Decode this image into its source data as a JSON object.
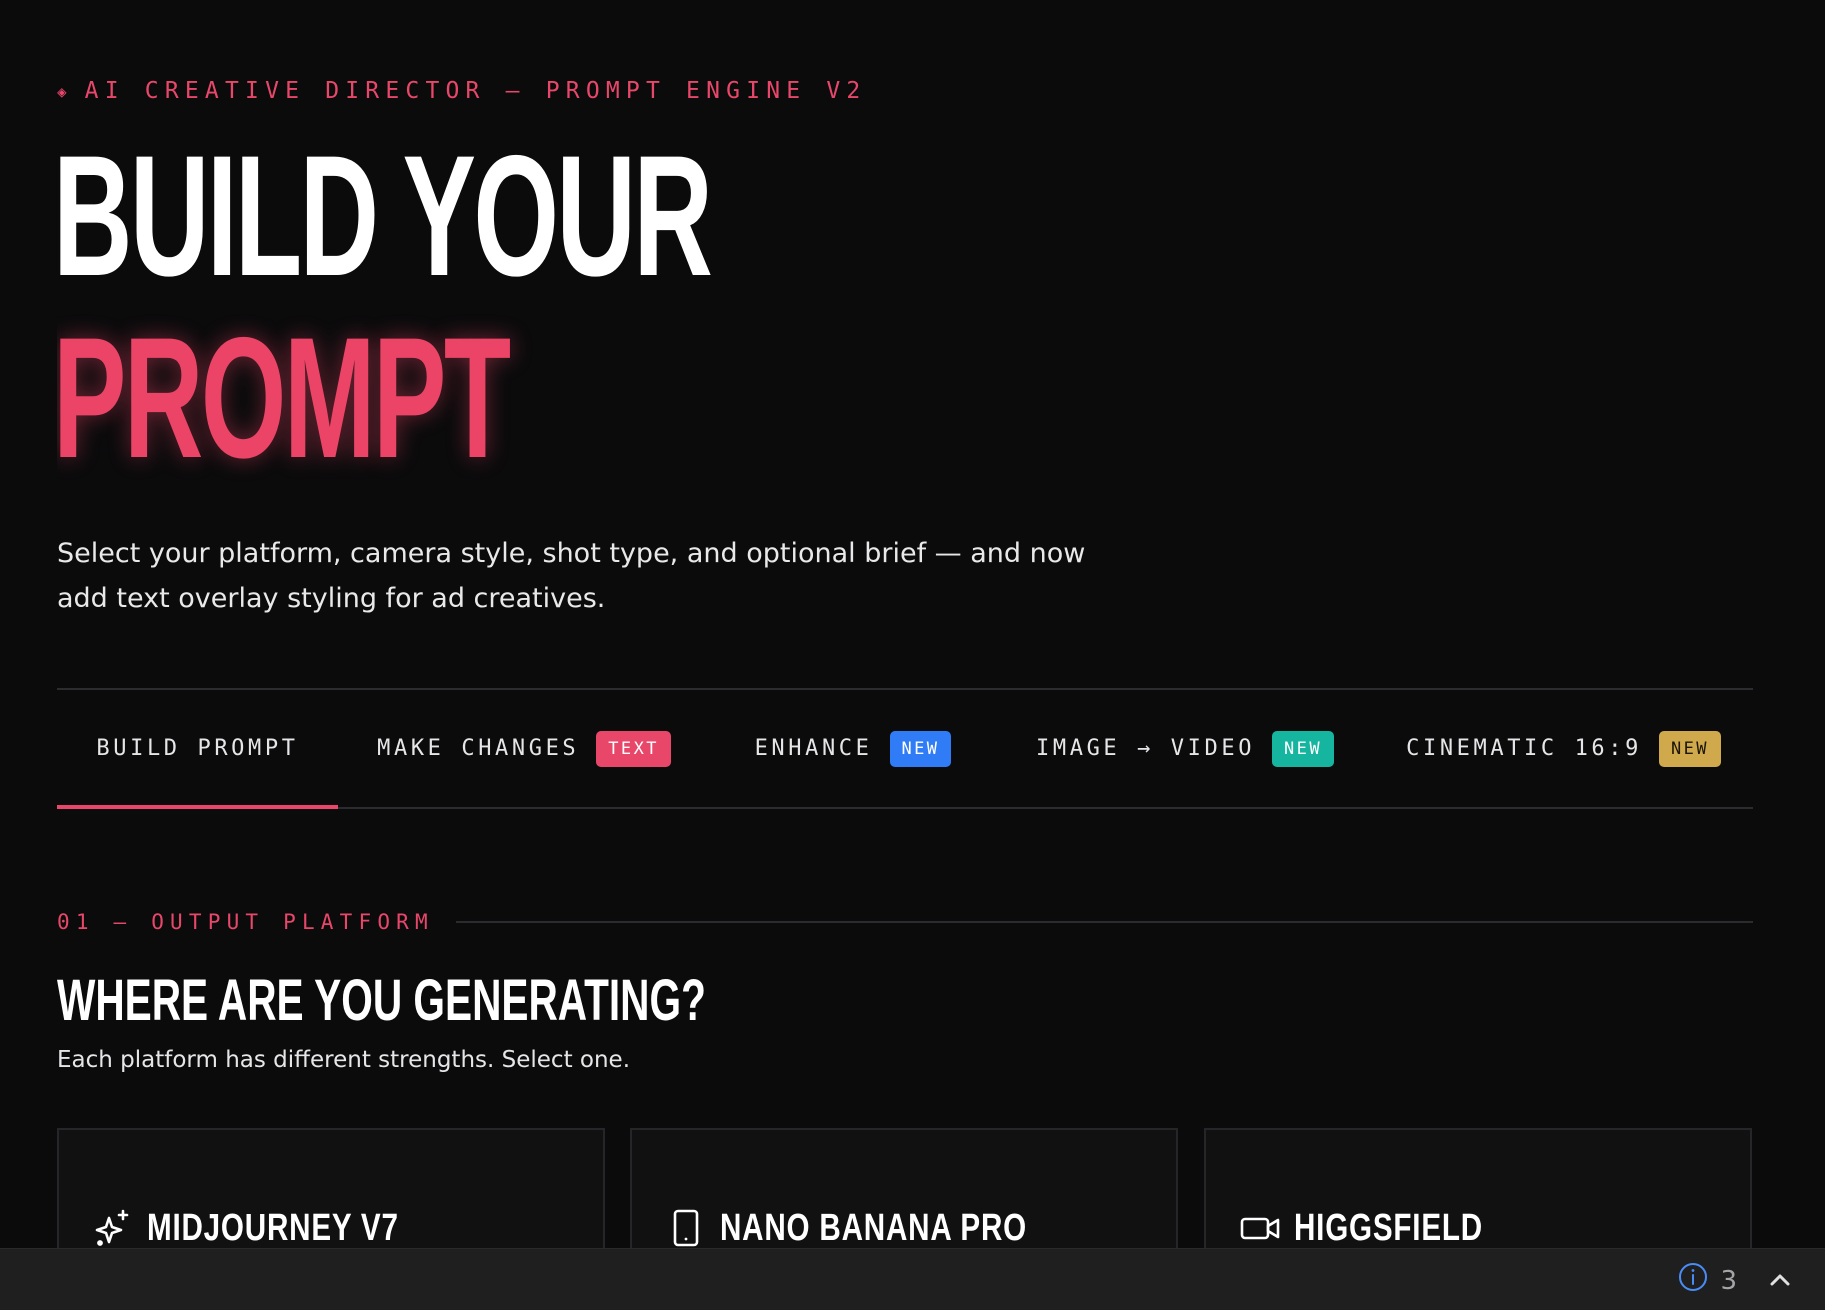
{
  "header": {
    "eyebrow_icon": "◈",
    "eyebrow": "AI CREATIVE DIRECTOR — PROMPT ENGINE V2",
    "title_line1": "BUILD YOUR",
    "title_line2": "PROMPT",
    "description": "Select your platform, camera style, shot type, and optional brief — and now add text overlay styling for ad creatives."
  },
  "tabs": [
    {
      "label": "BUILD PROMPT",
      "badge": "",
      "active": true
    },
    {
      "label": "MAKE CHANGES",
      "badge": "TEXT",
      "badge_color": "#e8476a"
    },
    {
      "label": "ENHANCE",
      "badge": "NEW",
      "badge_color": "#2f7cf6"
    },
    {
      "label": "IMAGE → VIDEO",
      "badge": "NEW",
      "badge_color": "#16b5a0"
    },
    {
      "label": "CINEMATIC 16:9",
      "badge": "NEW",
      "badge_color": "#d0a94d"
    }
  ],
  "section": {
    "label": "01 — OUTPUT PLATFORM",
    "title": "WHERE ARE YOU GENERATING?",
    "subtitle": "Each platform has different strengths. Select one."
  },
  "platforms": [
    {
      "name": "MIDJOURNEY V7",
      "icon": "sparkles-icon"
    },
    {
      "name": "NANO BANANA PRO",
      "icon": "phone-icon"
    },
    {
      "name": "HIGGSFIELD",
      "icon": "video-camera-icon"
    }
  ],
  "status_bar": {
    "count": "3",
    "icon": "info-icon",
    "toggle_icon": "chevron-up-icon"
  },
  "colors": {
    "accent": "#e8476a",
    "background": "#0b0b0c",
    "card": "#111112"
  }
}
